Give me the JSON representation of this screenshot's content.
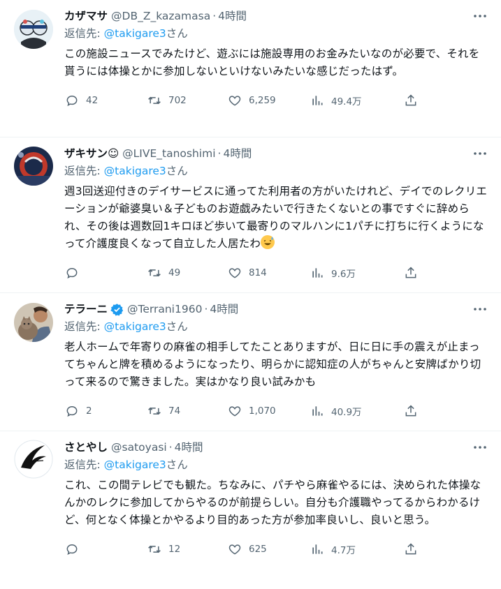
{
  "reply_prefix": "返信先: ",
  "reply_suffix": "さん",
  "tweets": [
    {
      "name": "カザマサ",
      "handle": "@DB_Z_kazamasa",
      "time": "4時間",
      "reply_to": "@takigare3",
      "text": "この施設ニュースでみたけど、遊ぶには施設専用のお金みたいなのが必要で、それを貰うには体操とかに参加しないといけないみたいな感じだったはず。",
      "replies": "42",
      "retweets": "702",
      "likes": "6,259",
      "views": "49.4万"
    },
    {
      "name": "ザキサン☺",
      "handle": "@LIVE_tanoshimi",
      "time": "4時間",
      "reply_to": "@takigare3",
      "text": "週3回送迎付きのデイサービスに通ってた利用者の方がいたけれど、デイでのレクリエーションが爺婆臭い＆子どものお遊戯みたいで行きたくないとの事ですぐに辞められ、その後は週数回1キロほど歩いて最寄りのマルハンに1パチに打ちに行くようになって介護度良くなって自立した人居たわ",
      "replies": "",
      "retweets": "49",
      "likes": "814",
      "views": "9.6万"
    },
    {
      "name": "テラーニ",
      "handle": "@Terrani1960",
      "time": "4時間",
      "reply_to": "@takigare3",
      "text": "老人ホームで年寄りの麻雀の相手してたことありますが、日に日に手の震えが止まってちゃんと牌を積めるようになったり、明らかに認知症の人がちゃんと安牌ばかり切って来るので驚きました。実はかなり良い試みかも",
      "replies": "2",
      "retweets": "74",
      "likes": "1,070",
      "views": "40.9万"
    },
    {
      "name": "さとやし",
      "handle": "@satoyasi",
      "time": "4時間",
      "reply_to": "@takigare3",
      "text": "これ、この間テレビでも観た。ちなみに、パチやら麻雀やるには、決められた体操なんかのレクに参加してからやるのが前提らしい。自分も介護職やってるからわかるけど、何となく体操とかやるより目的あった方が参加率良いし、良いと思う。",
      "replies": "",
      "retweets": "12",
      "likes": "625",
      "views": "4.7万"
    }
  ],
  "colors": {
    "link": "#1d9bf0",
    "secondary": "#536471",
    "primary": "#0f1419",
    "border": "#eff3f4"
  }
}
